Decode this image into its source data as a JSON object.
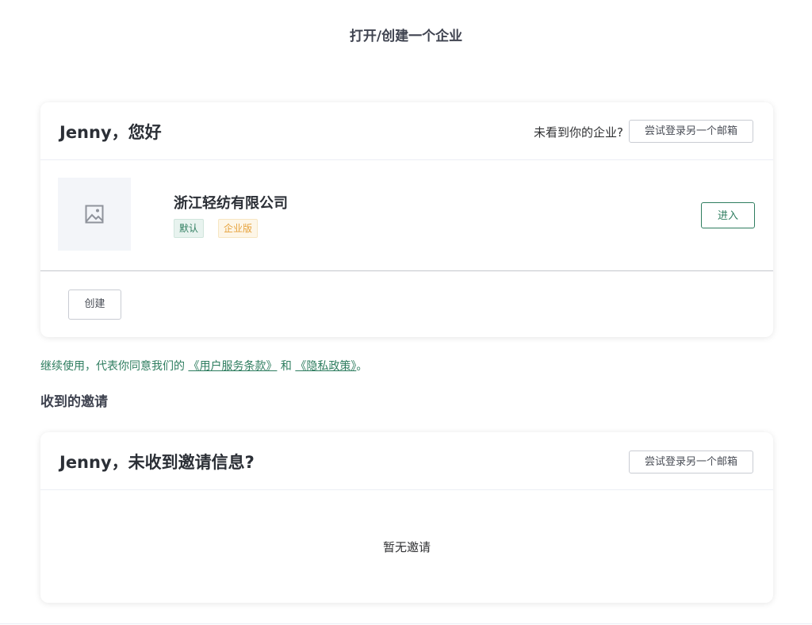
{
  "page": {
    "title": "打开/创建一个企业"
  },
  "companies_card": {
    "greeting": "Jenny，您好",
    "not_see_text": "未看到你的企业?",
    "switch_email_label": "尝试登录另一个邮箱",
    "company": {
      "logo_icon": "image-placeholder-icon",
      "name": "浙江轻纺有限公司",
      "tag_default": "默认",
      "tag_edition": "企业版",
      "enter_label": "进入"
    },
    "create_label": "创建"
  },
  "agreement": {
    "prefix": "继续使用，代表你同意我们的",
    "terms_link": "《用户服务条款》",
    "and_text": "和",
    "privacy_link": "《隐私政策》",
    "suffix": "。"
  },
  "invitations": {
    "section_title": "收到的邀请",
    "greeting": "Jenny，未收到邀请信息?",
    "switch_email_label": "尝试登录另一个邮箱",
    "empty_text": "暂无邀请"
  },
  "colors": {
    "accent": "#2e7d5f",
    "warning": "#e6a23c"
  }
}
